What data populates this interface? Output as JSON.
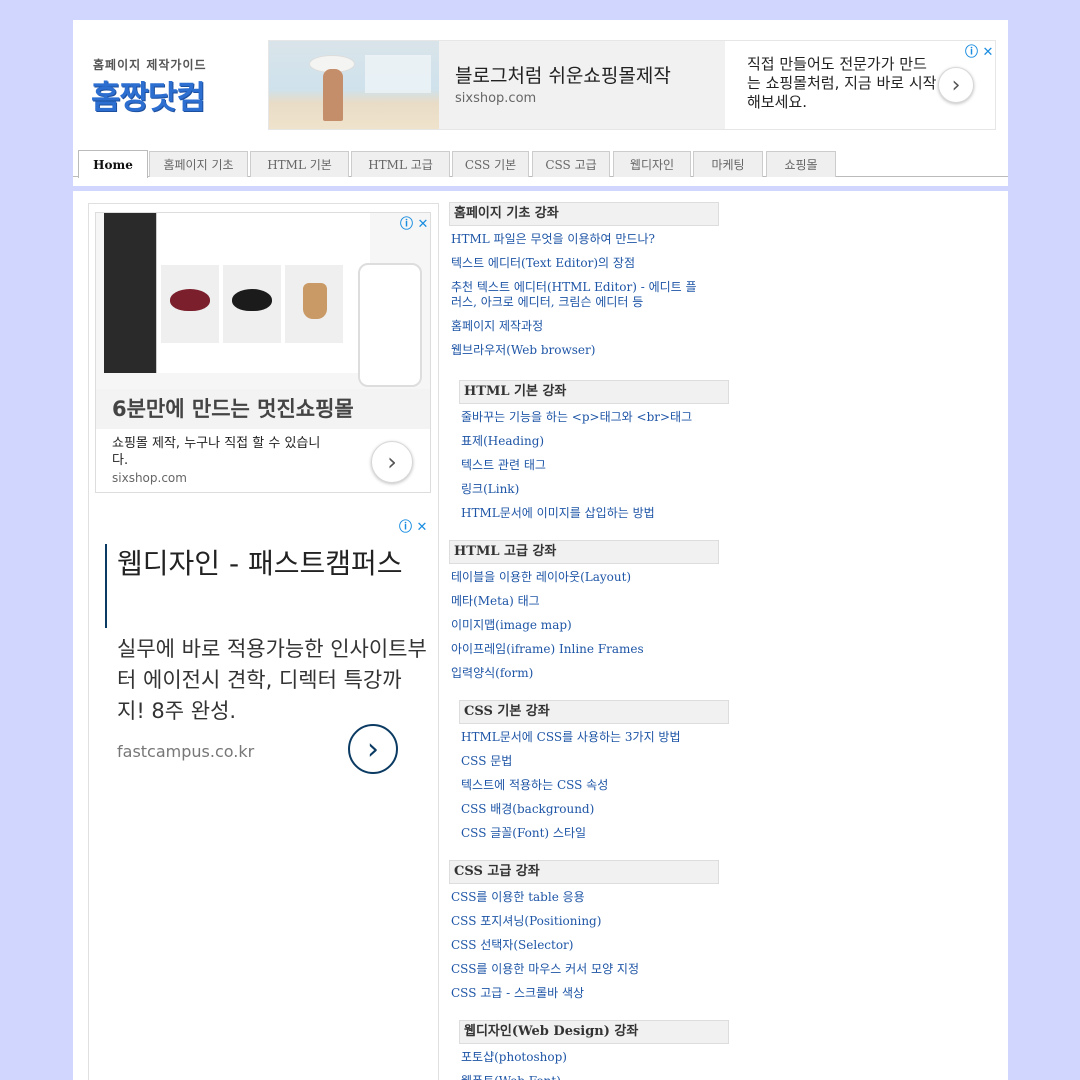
{
  "logo": {
    "sub": "홈페이지 제작가이드",
    "main": "홈짱닷컴"
  },
  "top_ad": {
    "title": "블로그처럼 쉬운쇼핑몰제작",
    "url": "sixshop.com",
    "description": "직접 만들어도 전문가가 만드는 쇼핑몰처럼, 지금 바로 시작해보세요.",
    "arrow": "›",
    "adchoice": "ⓘ ✕"
  },
  "nav": {
    "tabs": [
      "Home",
      "홈페이지 기초",
      "HTML 기본",
      "HTML 고급",
      "CSS 기본",
      "CSS 고급",
      "웹디자인",
      "마케팅",
      "쇼핑몰"
    ],
    "active": "Home"
  },
  "shop_ad": {
    "title": "6분만에 만드는 멋진쇼핑몰",
    "description": "쇼핑몰 제작, 누구나 직접 할 수 있습니다.",
    "url": "sixshop.com",
    "arrow": "›",
    "adchoice": "ⓘ ✕"
  },
  "fc_ad": {
    "headline": "웹디자인 - 패스트캠퍼스",
    "description": "실무에 바로 적용가능한 인사이트부터 에이전시 견학, 디렉터 특강까지! 8주 완성.",
    "url": "fastcampus.co.kr",
    "arrow": "›",
    "adchoice": "ⓘ ✕"
  },
  "sections": [
    {
      "title": "홈페이지 기초 강좌",
      "links": [
        "HTML 파일은 무엇을 이용하여 만드나?",
        "텍스트 에디터(Text Editor)의 장점",
        "추천 텍스트 에디터(HTML Editor) - 에디트 플러스, 아크로 에디터, 크림슨 에디터 등",
        "홈페이지 제작과정",
        "웹브라우저(Web browser)"
      ]
    },
    {
      "title": "HTML 기본 강좌",
      "links": [
        "줄바꾸는 기능을 하는 <p>태그와 <br>태그",
        "표제(Heading)",
        "텍스트 관련 태그",
        "링크(Link)",
        "HTML문서에 이미지를 삽입하는 방법"
      ]
    },
    {
      "title": "HTML 고급 강좌",
      "links": [
        "테이블을 이용한 레이아웃(Layout)",
        "메타(Meta) 태그",
        "이미지맵(image map)",
        "아이프레임(iframe) Inline Frames",
        "입력양식(form)"
      ]
    },
    {
      "title": "CSS 기본 강좌",
      "links": [
        "HTML문서에 CSS를 사용하는 3가지 방법",
        "CSS 문법",
        "텍스트에 적용하는 CSS 속성",
        "CSS 배경(background)",
        "CSS 글꼴(Font) 스타일"
      ]
    },
    {
      "title": "CSS 고급 강좌",
      "links": [
        "CSS를 이용한 table 응용",
        "CSS 포지셔닝(Positioning)",
        "CSS 선택자(Selector)",
        "CSS를 이용한 마우스 커서 모양 지정",
        "CSS 고급 - 스크롤바 색상"
      ]
    },
    {
      "title": "웹디자인(Web Design) 강좌",
      "links": [
        "포토샵(photoshop)",
        "웹폰트(Web Font)"
      ]
    }
  ]
}
